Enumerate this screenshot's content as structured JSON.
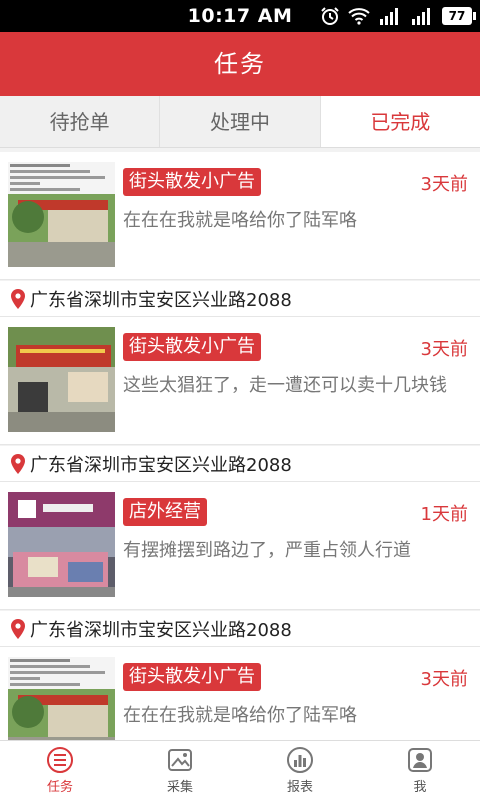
{
  "status_bar": {
    "time": "10:17 AM",
    "battery": "77"
  },
  "header": {
    "title": "任务"
  },
  "tabs": [
    {
      "label": "待抢单",
      "active": false
    },
    {
      "label": "处理中",
      "active": false
    },
    {
      "label": "已完成",
      "active": true
    }
  ],
  "tasks": [
    {
      "tag": "街头散发小广告",
      "time_ago": "3天前",
      "description": "在在在我就是咯给你了陆军咯",
      "address": "广东省深圳市宝安区兴业路2088"
    },
    {
      "tag": "街头散发小广告",
      "time_ago": "3天前",
      "description": "这些太猖狂了，走一遭还可以卖十几块钱",
      "address": "广东省深圳市宝安区兴业路2088"
    },
    {
      "tag": "店外经营",
      "time_ago": "1天前",
      "description": "有摆摊摆到路边了，严重占领人行道",
      "address": "广东省深圳市宝安区兴业路2088"
    },
    {
      "tag": "街头散发小广告",
      "time_ago": "3天前",
      "description": "在在在我就是咯给你了陆军咯",
      "address": ""
    }
  ],
  "bottom_nav": [
    {
      "label": "任务",
      "icon": "list-icon",
      "active": true
    },
    {
      "label": "采集",
      "icon": "image-icon",
      "active": false
    },
    {
      "label": "报表",
      "icon": "chart-icon",
      "active": false
    },
    {
      "label": "我",
      "icon": "user-icon",
      "active": false
    }
  ],
  "colors": {
    "accent": "#d9383b"
  }
}
